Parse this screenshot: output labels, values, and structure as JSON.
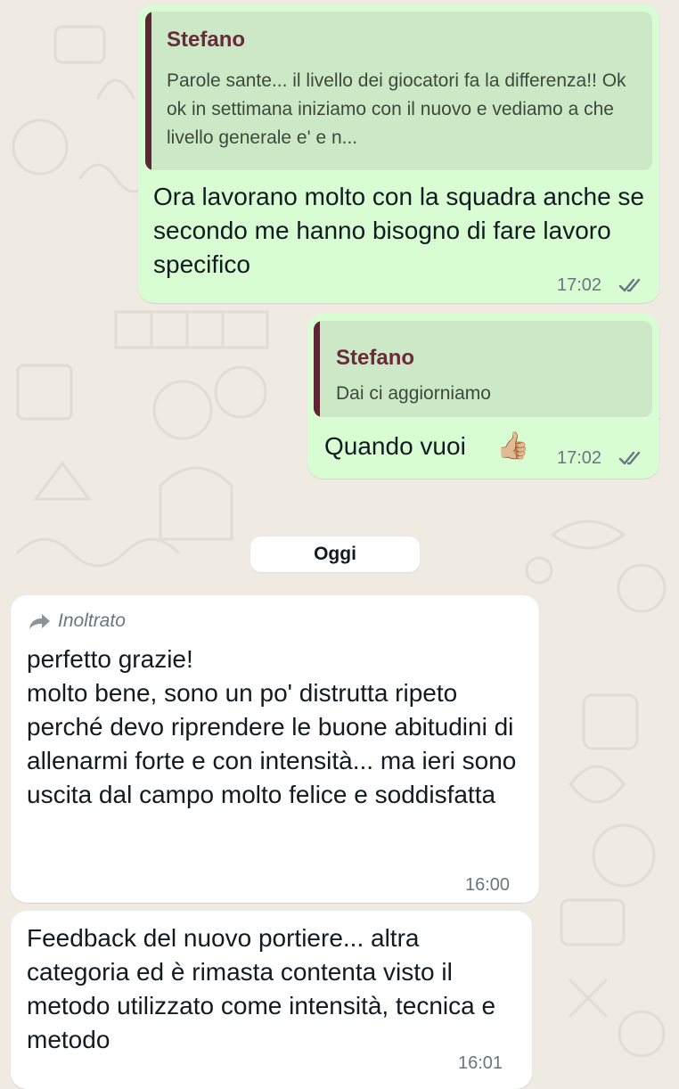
{
  "chat": {
    "messages": [
      {
        "quote_name": "Stefano",
        "quote_text": "Parole sante... il livello dei giocatori fa la differenza!! Ok ok in settimana iniziamo con il nuovo e vediamo a che livello generale e' e n...",
        "text": "Ora lavorano molto con la squadra anche se secondo me hanno bisogno di fare lavoro specifico",
        "time": "17:02"
      },
      {
        "quote_name": "Stefano",
        "quote_text": "Dai ci aggiorniamo",
        "text": "Quando vuoi",
        "emoji": "👍🏼",
        "time": "17:02"
      },
      {
        "forwarded_label": "Inoltrato",
        "text": "perfetto grazie!\nmolto bene, sono un po' distrutta ripeto perché devo riprendere le buone abitudini di allenarmi forte e con intensità... ma ieri sono uscita dal campo molto felice e soddisfatta",
        "time": "16:00"
      },
      {
        "text": "Feedback del nuovo portiere... altra categoria ed è rimasta contenta visto il metodo utilizzato come intensità, tecnica e metodo",
        "time": "16:01"
      }
    ],
    "day_separator": "Oggi"
  },
  "colors": {
    "background": "#efeae2",
    "outgoing_bubble": "#d9fdd3",
    "incoming_bubble": "#ffffff",
    "quote_name": "#6b2a3b",
    "read_ticks": "#667781"
  }
}
